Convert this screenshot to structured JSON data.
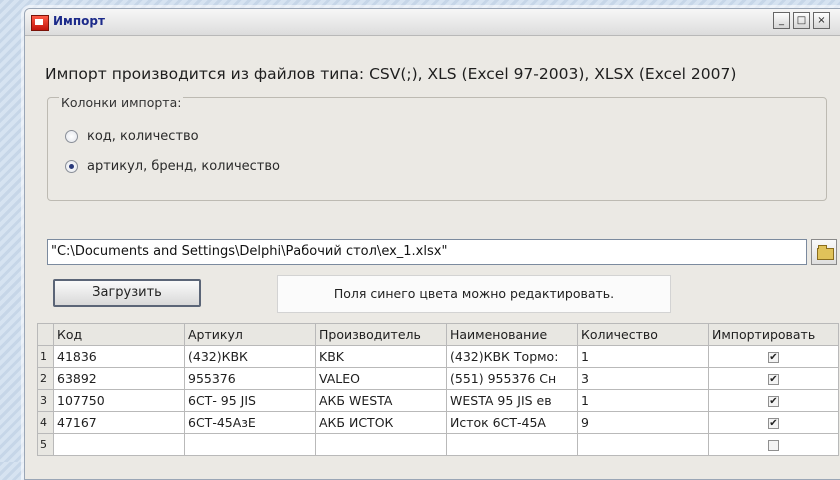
{
  "window": {
    "title": "Импорт",
    "minimize": "_",
    "maximize": "□",
    "close": "×"
  },
  "heading": "Импорт производится из файлов типа: CSV(;), XLS (Excel 97-2003), XLSX (Excel 2007)",
  "columns_group": {
    "label": "Колонки импорта:",
    "options": [
      {
        "label": "код, количество",
        "checked": false
      },
      {
        "label": "артикул, бренд, количество",
        "checked": true
      }
    ]
  },
  "file_path": "\"C:\\Documents and Settings\\Delphi\\Рабочий стол\\ex_1.xlsx\"",
  "load_button": "Загрузить",
  "note": "Поля синего цвета можно редактировать.",
  "table": {
    "headers": [
      "Код",
      "Артикул",
      "Производитель",
      "Наименование",
      "Количество",
      "Импортировать"
    ],
    "rows": [
      {
        "num": "1",
        "code": "41836",
        "article": "(432)КВК",
        "maker": "KBK",
        "name": "(432)КВК Тормо:",
        "qty": "1",
        "import": true
      },
      {
        "num": "2",
        "code": "63892",
        "article": "955376",
        "maker": "VALEO",
        "name": "(551) 955376 Сн",
        "qty": "3",
        "import": true
      },
      {
        "num": "3",
        "code": "107750",
        "article": "6СТ- 95 JIS",
        "maker": "АКБ WESTA",
        "name": "WESTA 95 JIS ев",
        "qty": "1",
        "import": true
      },
      {
        "num": "4",
        "code": "47167",
        "article": "6СТ-45АзЕ",
        "maker": "АКБ ИСТОК",
        "name": "Исток  6СТ-45А",
        "qty": "9",
        "import": true
      },
      {
        "num": "5",
        "code": "",
        "article": "",
        "maker": "",
        "name": "",
        "qty": "",
        "import": false
      }
    ]
  }
}
